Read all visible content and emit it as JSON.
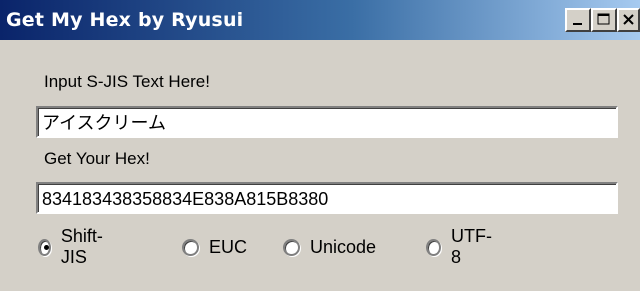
{
  "window": {
    "title": "Get My Hex by Ryusui",
    "controls": {
      "minimize": "minimize-icon",
      "maximize": "maximize-icon",
      "close": "close-icon"
    }
  },
  "input": {
    "label": "Input S-JIS Text Here!",
    "value": "アイスクリーム"
  },
  "output": {
    "label": "Get Your Hex!",
    "value": "834183438358834E838A815B8380"
  },
  "encodings": {
    "selected": "Shift-JIS",
    "options": [
      "Shift-JIS",
      "EUC",
      "Unicode",
      "UTF-8"
    ]
  }
}
